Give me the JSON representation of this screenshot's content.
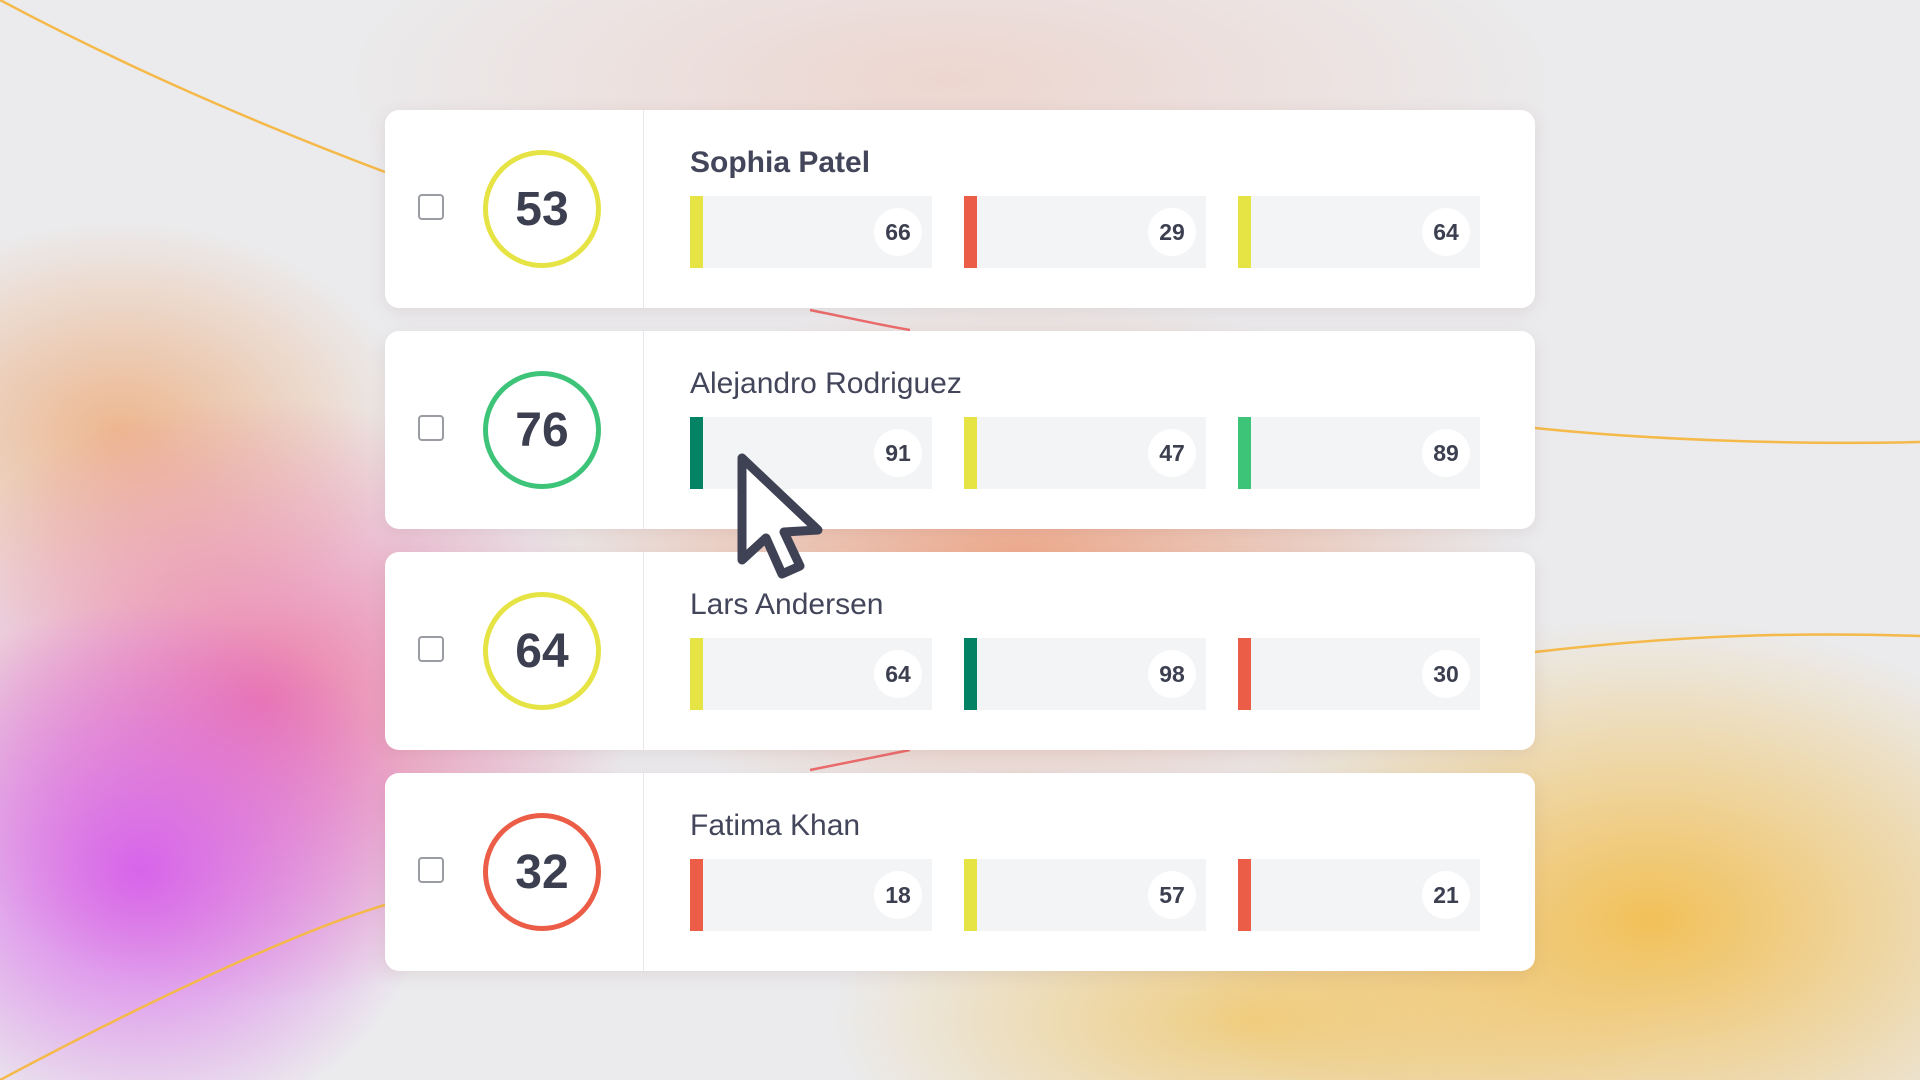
{
  "colors": {
    "yellow": "#e6e344",
    "red": "#ec5d47",
    "dark_green": "#038264",
    "green": "#3ec479",
    "text": "#3c3f4f",
    "card": "#ffffff"
  },
  "rows": [
    {
      "name": "Sophia Patel",
      "score": "53",
      "score_color": "yellow",
      "metrics": [
        {
          "value": "66",
          "color": "yellow"
        },
        {
          "value": "29",
          "color": "red"
        },
        {
          "value": "64",
          "color": "yellow"
        }
      ]
    },
    {
      "name": "Alejandro Rodriguez",
      "score": "76",
      "score_color": "green",
      "metrics": [
        {
          "value": "91",
          "color": "dark_green"
        },
        {
          "value": "47",
          "color": "yellow"
        },
        {
          "value": "89",
          "color": "green"
        }
      ]
    },
    {
      "name": "Lars Andersen",
      "score": "64",
      "score_color": "yellow",
      "metrics": [
        {
          "value": "64",
          "color": "yellow"
        },
        {
          "value": "98",
          "color": "dark_green"
        },
        {
          "value": "30",
          "color": "red"
        }
      ]
    },
    {
      "name": "Fatima Khan",
      "score": "32",
      "score_color": "red",
      "metrics": [
        {
          "value": "18",
          "color": "red"
        },
        {
          "value": "57",
          "color": "yellow"
        },
        {
          "value": "21",
          "color": "red"
        }
      ]
    }
  ],
  "icons": {
    "cursor": "mouse-pointer-icon",
    "checkbox": "checkbox-unchecked"
  }
}
